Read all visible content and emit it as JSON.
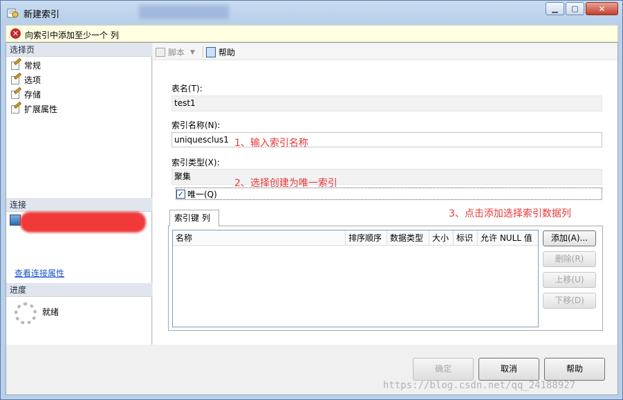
{
  "window": {
    "title": "新建索引"
  },
  "error_bar": {
    "message": "向索引中添加至少一个 列"
  },
  "left_pane": {
    "pages_header": "选择页",
    "pages": [
      {
        "label": "常规",
        "icon": "page-edit-icon"
      },
      {
        "label": "选项",
        "icon": "page-edit-icon"
      },
      {
        "label": "存储",
        "icon": "page-edit-icon"
      },
      {
        "label": "扩展属性",
        "icon": "page-edit-icon"
      }
    ],
    "connection_header": "连接",
    "view_connection_link": "查看连接属性",
    "progress_header": "进度",
    "progress_status": "就绪"
  },
  "toolbar": {
    "script_label": "脚本",
    "help_label": "帮助"
  },
  "form": {
    "table_name_label": "表名(T):",
    "table_name_value": "test1",
    "index_name_label": "索引名称(N):",
    "index_name_value": "uniquesclus1",
    "index_type_label": "索引类型(X):",
    "index_type_value": "聚集",
    "unique_label": "唯一(Q)",
    "unique_checked": true
  },
  "annotations": {
    "step1": "1、输入索引名称",
    "step2": "2、选择创建为唯一索引",
    "step3": "3、点击添加选择索引数据列"
  },
  "key_columns": {
    "tab_label": "索引键 列",
    "columns": [
      "名称",
      "排序顺序",
      "数据类型",
      "大小",
      "标识",
      "允许 NULL 值"
    ],
    "rows": [],
    "buttons": {
      "add": "添加(A)...",
      "remove": "删除(R)",
      "move_up": "上移(U)",
      "move_down": "下移(D)"
    }
  },
  "dialog_buttons": {
    "ok": "确定",
    "cancel": "取消",
    "help": "帮助"
  },
  "watermark": "https://blog.csdn.net/qq_24188927"
}
